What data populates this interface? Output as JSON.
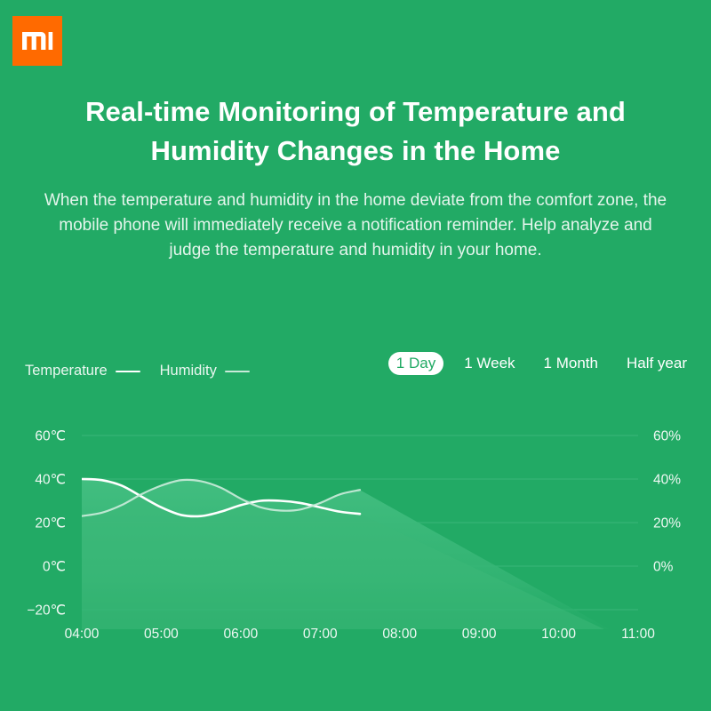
{
  "brand": {
    "logo_icon": "xiaomi-mi-logo",
    "logo_bg": "#ff6a00",
    "logo_fg": "#ffffff"
  },
  "theme": {
    "background": "#22aa65",
    "text": "#ffffff",
    "muted_text": "#e4f5ec",
    "area_fill": "#3cb878",
    "temp_line": "#ffffff",
    "hum_line": "#c9ead9",
    "grid": "#4cc08a"
  },
  "header": {
    "title": "Real-time Monitoring of Temperature and Humidity Changes in the Home",
    "description": "When the temperature and humidity in the home deviate from the comfort zone, the mobile phone will immediately receive a notification reminder. Help analyze and judge the temperature and humidity in your home."
  },
  "legend": {
    "items": [
      {
        "label": "Temperature",
        "color": "#ffffff",
        "key": "temp"
      },
      {
        "label": "Humidity",
        "color": "#c9ead9",
        "key": "hum"
      }
    ]
  },
  "range_selector": {
    "selected": "1 Day",
    "options": [
      {
        "label": "1 Day",
        "active": true
      },
      {
        "label": "1 Week",
        "active": false
      },
      {
        "label": "1 Month",
        "active": false
      },
      {
        "label": "Half year",
        "active": false
      }
    ]
  },
  "chart_data": {
    "type": "line",
    "title": "",
    "xlabel": "",
    "ylabel": "Temperature",
    "y2label": "Humidity",
    "grid": true,
    "legend_position": "top-left",
    "x": [
      "04:00",
      "05:00",
      "06:00",
      "07:00",
      "08:00",
      "09:00",
      "10:00",
      "11:00"
    ],
    "xtick_labels": [
      "04:00",
      "05:00",
      "06:00",
      "07:00",
      "08:00",
      "09:00",
      "10:00",
      "11:00"
    ],
    "ytick_labels": [
      "60℃",
      "40℃",
      "20℃",
      "0℃",
      "−20℃"
    ],
    "ytick_values": [
      60,
      40,
      20,
      0,
      -20
    ],
    "y2tick_labels": [
      "60%",
      "40%",
      "20%",
      "0%"
    ],
    "y2tick_values": [
      60,
      40,
      20,
      0
    ],
    "ylim": [
      -20,
      60
    ],
    "y2lim": [
      -20,
      60
    ],
    "series": [
      {
        "name": "Temperature",
        "unit": "℃",
        "axis": "left",
        "color": "#ffffff",
        "values": [
          40,
          37,
          28,
          24,
          28,
          30,
          27,
          24
        ],
        "x_dense": [
          0,
          0.5,
          1,
          1.5,
          2,
          2.5,
          3,
          3.5,
          4,
          4.5,
          5,
          5.5,
          6,
          6.5,
          7
        ],
        "values_dense": [
          40,
          39.5,
          37,
          32,
          27,
          23.5,
          23,
          25,
          28,
          30,
          30,
          29,
          27,
          25,
          24
        ]
      },
      {
        "name": "Humidity",
        "unit": "%",
        "axis": "right",
        "color": "#c9ead9",
        "values": [
          23,
          27,
          36,
          39,
          31,
          26,
          30,
          35
        ],
        "x_dense": [
          0,
          0.5,
          1,
          1.5,
          2,
          2.5,
          3,
          3.5,
          4,
          4.5,
          5,
          5.5,
          6,
          6.5,
          7
        ],
        "values_dense": [
          23,
          24.5,
          28,
          33,
          37,
          39.5,
          39,
          36,
          31,
          27,
          25.5,
          26,
          29,
          33,
          35
        ]
      }
    ]
  }
}
